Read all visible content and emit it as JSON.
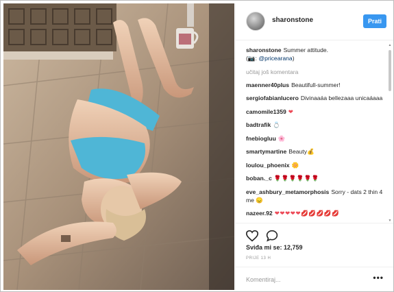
{
  "post": {
    "username": "sharonstone",
    "follow_label": "Prati",
    "caption_user": "sharonstone",
    "caption_text": "Summer attitude.",
    "caption_line2_prefix": "(📷: ",
    "caption_mention": "@pricearana",
    "caption_line2_suffix": ")",
    "load_more": "učitaj još komentara",
    "likes_text": "Sviđa mi se: 12,759",
    "time_text": "PRIJE 13 H",
    "comment_placeholder": "Komentiraj...",
    "more_label": "•••"
  },
  "comments": [
    {
      "user": "maenner40plus",
      "text": "Beautifull-summer!",
      "style": ""
    },
    {
      "user": "sergiofabianlucero",
      "text": "Divinaaáa bellezaaa unicaáaaa",
      "style": ""
    },
    {
      "user": "camomile1359",
      "text": "❤",
      "style": "hearts"
    },
    {
      "user": "badtrafik",
      "text": "💍",
      "style": ""
    },
    {
      "user": "fnebiogluu",
      "text": "🌸",
      "style": ""
    },
    {
      "user": "smartymartine",
      "text": "Beauty💰",
      "style": ""
    },
    {
      "user": "loulou_phoenix",
      "text": "🌼",
      "style": ""
    },
    {
      "user": "boban._c",
      "text": "🌹🌹🌹🌹🌹🌹",
      "style": "roses"
    },
    {
      "user": "eve_ashbury_metamorphosis",
      "text": "Sorry - dats 2 thin 4 me 😞",
      "style": ""
    },
    {
      "user": "nazeer.92",
      "text": "❤❤❤❤❤💋💋💋💋💋",
      "style": "hearts"
    }
  ],
  "icons": {
    "like": "heart-outline-icon",
    "comment": "speech-bubble-icon",
    "more": "ellipsis-icon"
  },
  "colors": {
    "accent": "#3897f0",
    "text": "#262626",
    "muted": "#999999",
    "heart": "#ed4956"
  }
}
